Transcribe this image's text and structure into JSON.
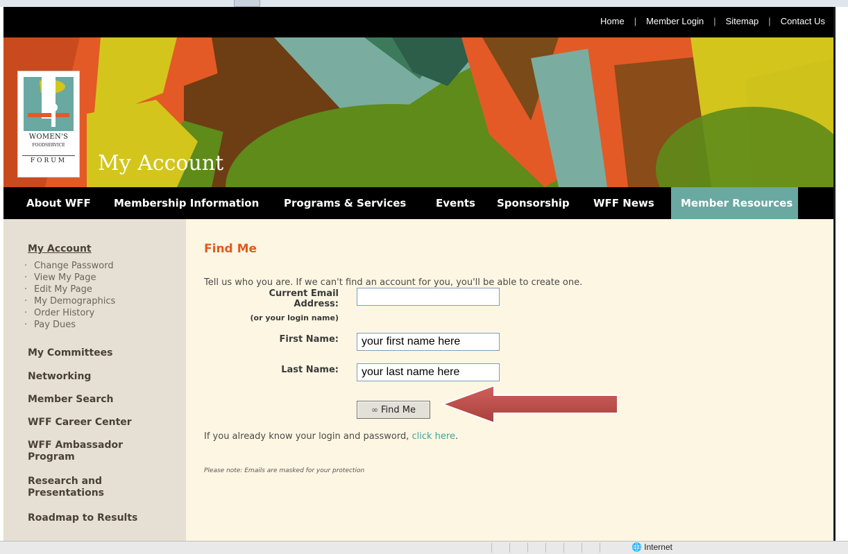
{
  "utility_nav": [
    "Home",
    "Member Login",
    "Sitemap",
    "Contact Us"
  ],
  "logo": {
    "line1": "WOMEN'S",
    "line2": "FOODSERVICE",
    "line3": "FORUM"
  },
  "page_title": "My Account",
  "main_nav": [
    {
      "label": "About WFF"
    },
    {
      "label": "Membership Information"
    },
    {
      "label": "Programs & Services"
    },
    {
      "label": "Events"
    },
    {
      "label": "Sponsorship"
    },
    {
      "label": "WFF News"
    },
    {
      "label": "Member Resources",
      "active": true
    }
  ],
  "sidebar": {
    "title": "My Account",
    "sub_items": [
      "Change Password",
      "View My Page",
      "Edit My Page",
      "My Demographics",
      "Order History",
      "Pay Dues"
    ],
    "sections": [
      "My Committees",
      "Networking",
      "Member Search",
      "WFF Career Center",
      "WFF Ambassador Program",
      "Research and Presentations",
      "Roadmap to Results"
    ]
  },
  "form": {
    "title": "Find Me",
    "intro": "Tell us who you are. If we can't find an account for you, you'll be able to create one.",
    "email_label": "Current Email Address:",
    "email_hint": "(or your login name)",
    "email_value": "",
    "first_name_label": "First Name:",
    "first_name_value": "your first name here",
    "last_name_label": "Last Name:",
    "last_name_value": "your last name here",
    "submit_label": "Find Me",
    "login_text": "If you already know your login and password, ",
    "login_link": "click here",
    "login_after": ".",
    "mask_note": "Please note: Emails are masked for your protection"
  },
  "status_bar": {
    "zone": "Internet"
  },
  "colors": {
    "accent_orange": "#e25a1c",
    "teal": "#6aa8a2",
    "link": "#3ea39b",
    "arrow": "#c0504d"
  }
}
